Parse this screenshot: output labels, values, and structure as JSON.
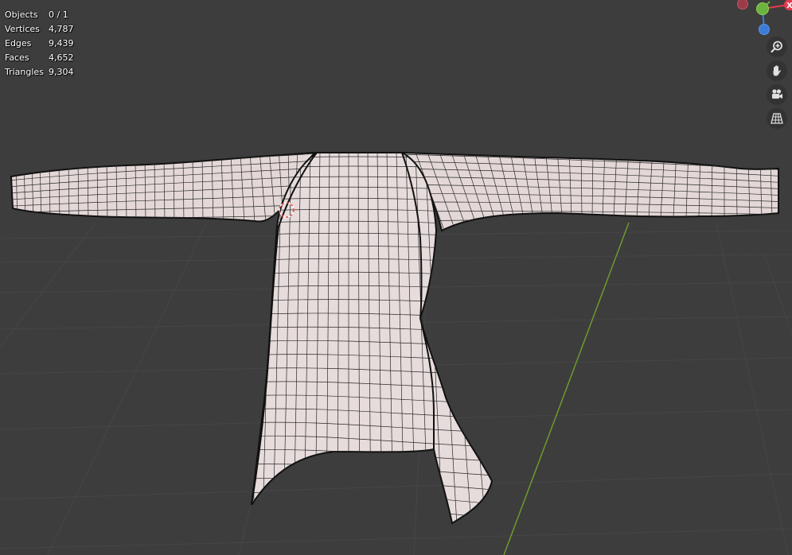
{
  "stats": {
    "rows": [
      {
        "label": "Objects",
        "value": "0 / 1"
      },
      {
        "label": "Vertices",
        "value": "4,787"
      },
      {
        "label": "Edges",
        "value": "9,439"
      },
      {
        "label": "Faces",
        "value": "4,652"
      },
      {
        "label": "Triangles",
        "value": "9,304"
      }
    ]
  },
  "gizmo": {
    "x_axis_label": "X",
    "x_color": "#e8394c",
    "y_color": "#6cb33f",
    "z_color": "#3d7bd6",
    "neg_x_color": "#9b3b48"
  },
  "nav_tools": [
    {
      "icon": "zoom-icon",
      "name": "zoom-button"
    },
    {
      "icon": "pan-hand-icon",
      "name": "pan-button"
    },
    {
      "icon": "camera-view-icon",
      "name": "camera-view-button"
    },
    {
      "icon": "perspective-grid-icon",
      "name": "perspective-toggle-button"
    }
  ],
  "colors": {
    "background": "#3d3d3d",
    "grid_line": "#454545",
    "y_axis_line": "#6c9a2e",
    "mesh_fill": "#e8dedd",
    "wire": "#1a1a1a"
  }
}
